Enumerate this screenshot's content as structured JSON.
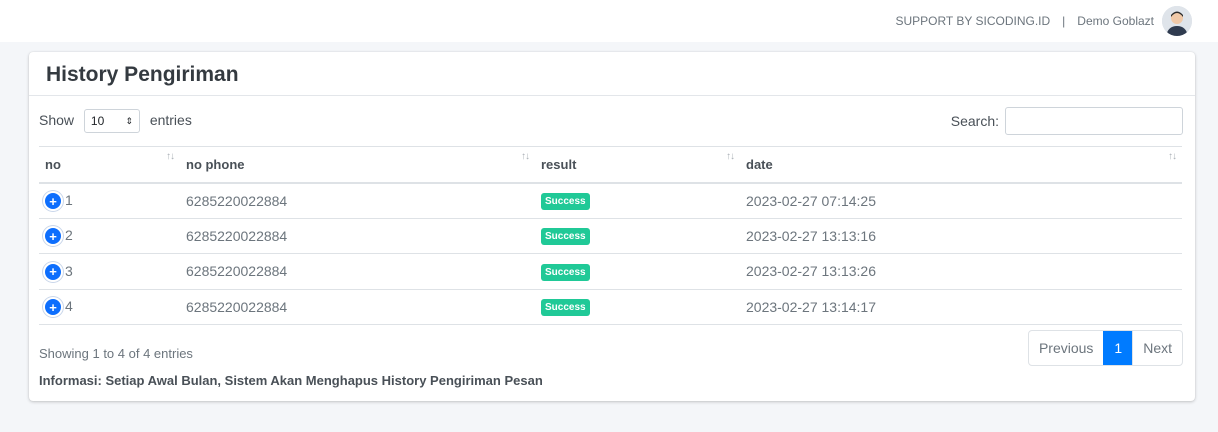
{
  "topbar": {
    "support_text": "SUPPORT BY SICODING.ID",
    "separator": "|",
    "user_name": "Demo Goblazt"
  },
  "card": {
    "title": "History Pengiriman"
  },
  "controls": {
    "show_label": "Show",
    "entries_value": "10",
    "entries_label": "entries",
    "search_label": "Search:",
    "search_value": ""
  },
  "table": {
    "headers": [
      "no",
      "no phone",
      "result",
      "date"
    ],
    "rows": [
      {
        "no": "1",
        "phone": "6285220022884",
        "result": "Success",
        "date": "2023-02-27 07:14:25"
      },
      {
        "no": "2",
        "phone": "6285220022884",
        "result": "Success",
        "date": "2023-02-27 13:13:16"
      },
      {
        "no": "3",
        "phone": "6285220022884",
        "result": "Success",
        "date": "2023-02-27 13:13:26"
      },
      {
        "no": "4",
        "phone": "6285220022884",
        "result": "Success",
        "date": "2023-02-27 13:14:17"
      }
    ]
  },
  "footer": {
    "showing_text": "Showing 1 to 4 of 4 entries",
    "note": "Informasi: Setiap Awal Bulan, Sistem Akan Menghapus History Pengiriman Pesan"
  },
  "pagination": {
    "previous": "Previous",
    "current": "1",
    "next": "Next"
  },
  "colors": {
    "badge_success": "#20c997",
    "primary": "#007bff"
  }
}
